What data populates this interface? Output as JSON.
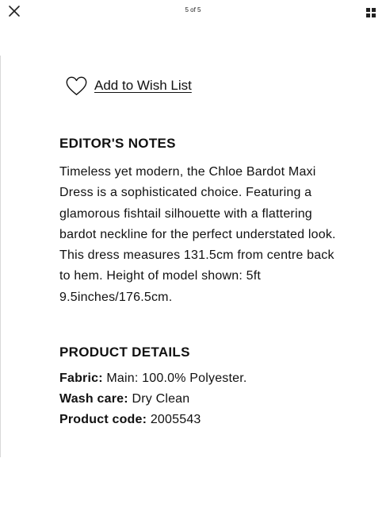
{
  "topbar": {
    "page_indicator": "5 of 5",
    "close_icon": "close-icon",
    "grid_icon": "grid-icon"
  },
  "wishlist": {
    "icon": "heart-icon",
    "label": "Add to Wish List"
  },
  "editors_notes": {
    "heading": "EDITOR'S NOTES",
    "lines": [
      "Timeless yet modern, the Chloe Bardot Maxi",
      "Dress is a sophisticated choice. Featuring a",
      "glamorous fishtail silhouette with a flattering",
      "bardot neckline for the perfect understated look.",
      "This dress measures 131.5cm from centre back",
      "to hem. Height of model shown: 5ft",
      "9.5inches/176.5cm."
    ]
  },
  "product_details": {
    "heading": "PRODUCT DETAILS",
    "fabric_label": "Fabric:",
    "fabric_value": "Main: 100.0% Polyester.",
    "wash_label": "Wash care:",
    "wash_value": "Dry Clean",
    "code_label": "Product code:",
    "code_value": "2005543"
  }
}
